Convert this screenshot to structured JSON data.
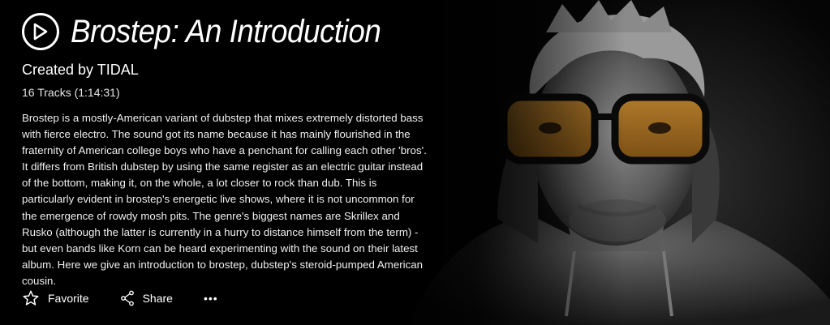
{
  "playlist": {
    "title": "Brostep: An Introduction",
    "creator": "Created by TIDAL",
    "tracks": "16 Tracks (1:14:31)",
    "description": "Brostep is a mostly-American variant of dubstep that mixes extremely distorted bass with fierce electro. The sound got its name because it has mainly flourished in the fraternity of American college boys who have a penchant for calling each other 'bros'. It differs from British dubstep by using the same register as an electric guitar instead of the bottom, making it, on the whole, a lot closer to rock than dub. This is particularly evident in brostep's energetic live shows, where it is not uncommon for the emergence of rowdy mosh pits. The genre's biggest names are Skrillex and Rusko (although the latter is currently in a hurry to distance himself from the term) - but even bands like Korn can be heard experimenting with the sound on their latest album. Here we give an introduction to brostep, dubstep's steroid-pumped American cousin."
  },
  "actions": {
    "favorite": "Favorite",
    "share": "Share",
    "more": "•••"
  },
  "icons": {
    "play": "play-circle-icon",
    "favorite": "star-outline-icon",
    "share": "share-icon",
    "more": "more-dots-icon"
  },
  "colors": {
    "background": "#000000",
    "text": "#ffffff"
  }
}
